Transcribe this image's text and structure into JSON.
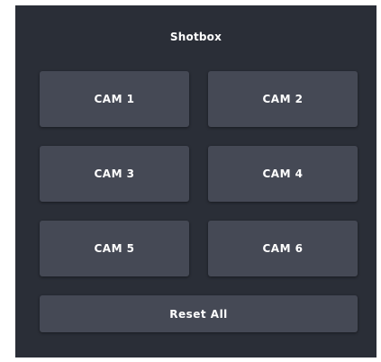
{
  "panel": {
    "title": "Shotbox",
    "background": "#2a2e37",
    "button_color": "#454955"
  },
  "buttons": [
    {
      "label": "CAM 1"
    },
    {
      "label": "CAM 2"
    },
    {
      "label": "CAM 3"
    },
    {
      "label": "CAM 4"
    },
    {
      "label": "CAM 5"
    },
    {
      "label": "CAM 6"
    }
  ],
  "reset": {
    "label": "Reset All"
  }
}
